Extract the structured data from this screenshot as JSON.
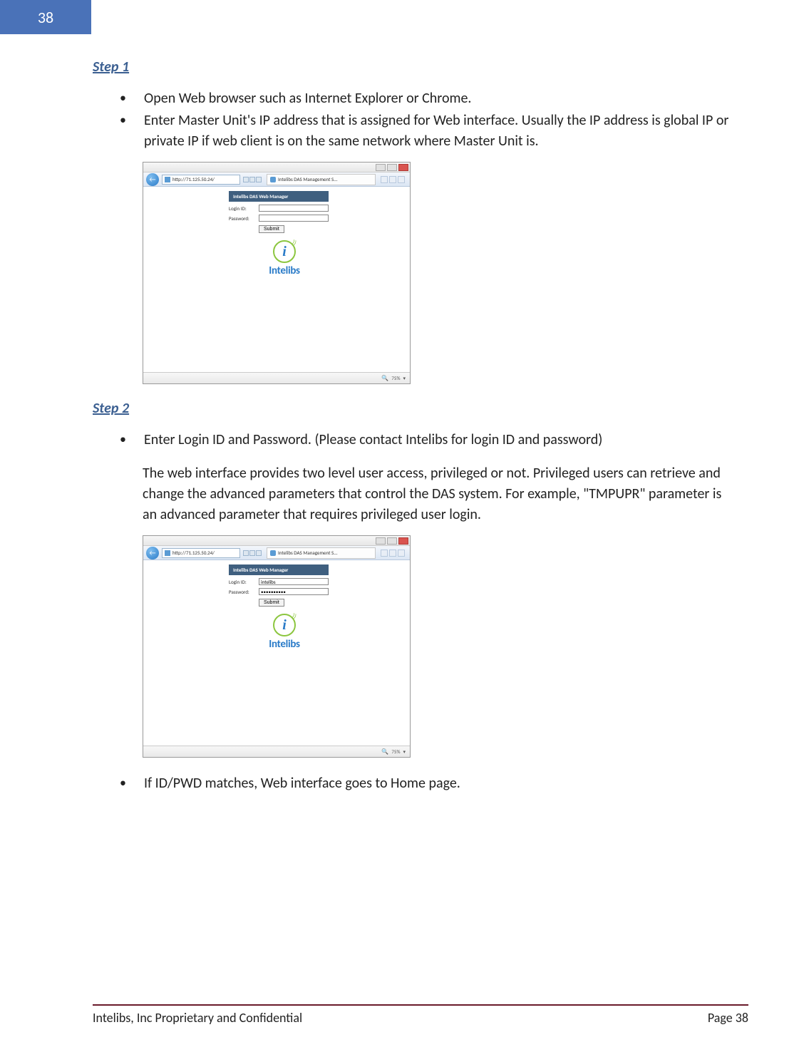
{
  "page_tab_number": "38",
  "step1": {
    "heading": "Step 1",
    "bullets": [
      "Open Web browser such as Internet Explorer or Chrome.",
      "Enter Master Unit's IP address that is assigned for Web interface. Usually the IP address is global IP or private IP if web client is on the same network where Master Unit is."
    ]
  },
  "step2": {
    "heading": "Step 2",
    "bullets_top": [
      "Enter Login ID and Password. (Please contact Intelibs for login ID and password)"
    ],
    "paragraph": "The web interface provides two level user access, privileged or not. Privileged users can retrieve and change the advanced parameters that control the DAS system. For example, \"TMPUPR\" parameter is an advanced parameter that requires privileged user login.",
    "bullets_bottom": [
      "If ID/PWD matches, Web interface goes to Home page."
    ]
  },
  "browser": {
    "url_text": "http://71.125.50.24/",
    "tab_title": "Intelibs DAS Management S...",
    "login_header": "Intelibs DAS Web Manager",
    "login_id_label": "Login ID:",
    "password_label": "Password:",
    "submit_label": "Submit",
    "logo_text": "Intelibs",
    "zoom_text": "75%",
    "screenshot1": {
      "login_value": "",
      "password_value": ""
    },
    "screenshot2": {
      "login_value": "intelibs",
      "password_value": "••••••••••"
    }
  },
  "footer": {
    "left": "Intelibs, Inc Proprietary and Confidential",
    "right": "Page 38"
  }
}
